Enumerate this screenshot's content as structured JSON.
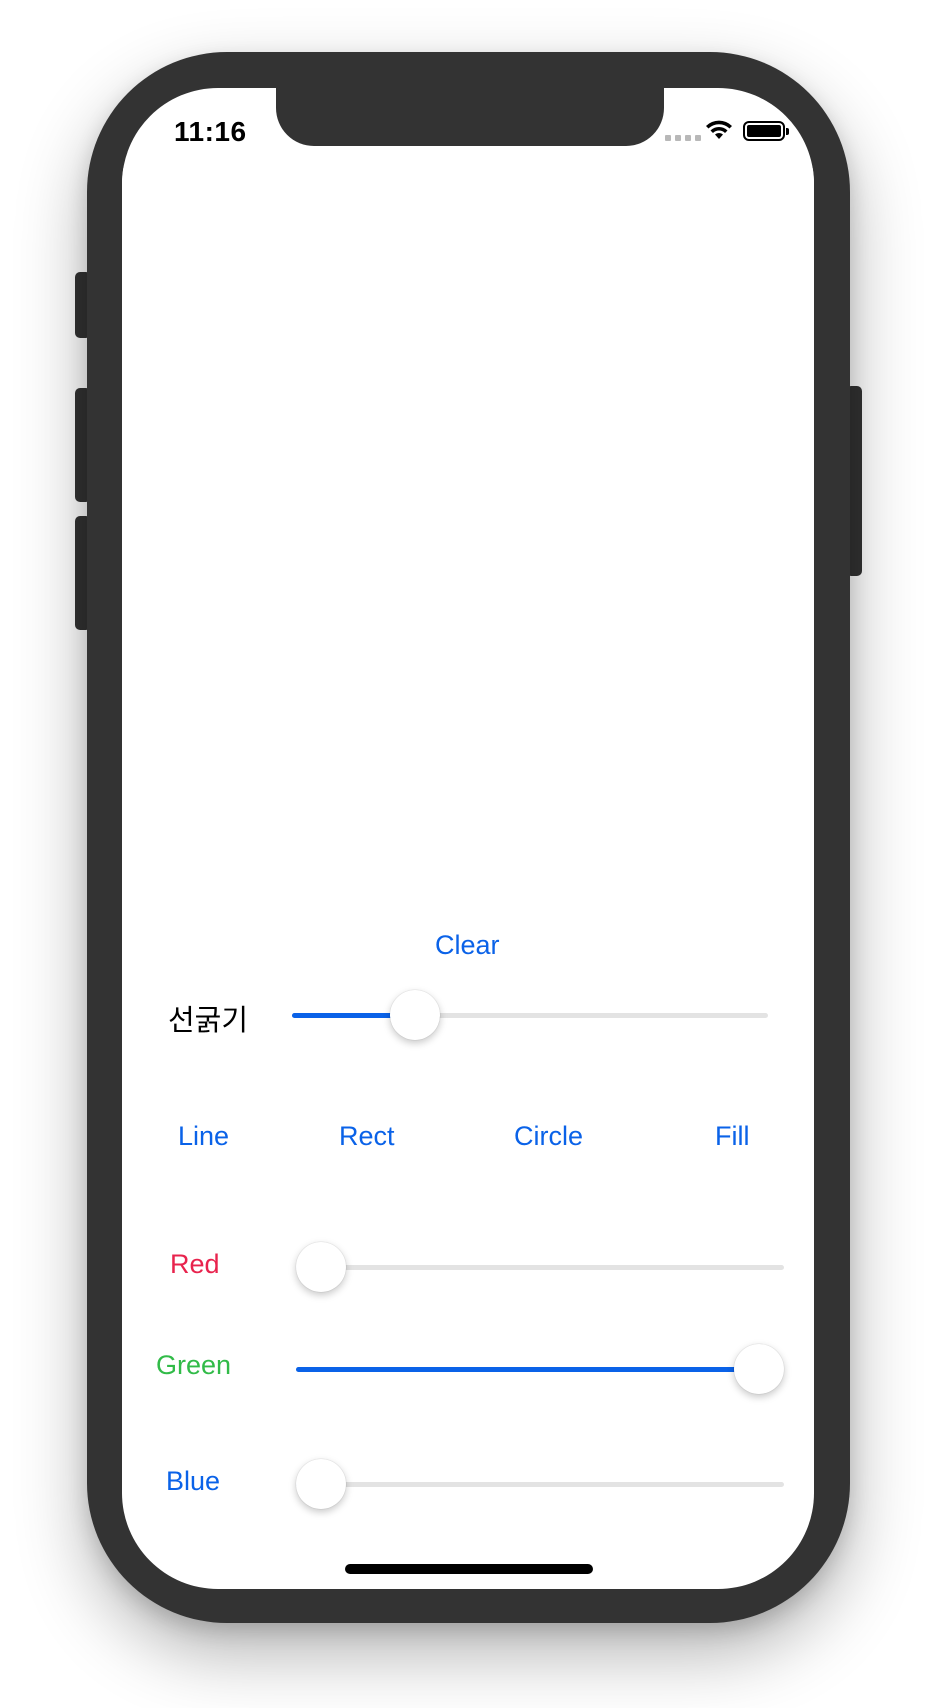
{
  "status_bar": {
    "time": "11:16",
    "icons": [
      "signal-icon",
      "wifi-icon",
      "battery-icon"
    ]
  },
  "toolbar": {
    "clear_label": "Clear"
  },
  "line_width": {
    "label": "선굵기",
    "value": 0.23
  },
  "shapes": {
    "line_label": "Line",
    "rect_label": "Rect",
    "circle_label": "Circle",
    "fill_label": "Fill"
  },
  "color": {
    "red_label": "Red",
    "red_value": 0.0,
    "green_label": "Green",
    "green_value": 1.0,
    "blue_label": "Blue",
    "blue_value": 0.0
  },
  "colors": {
    "accent": "#0a62e8",
    "red": "#e8234d",
    "green": "#31bb48",
    "blue": "#0a62e8",
    "device": "#333333"
  }
}
